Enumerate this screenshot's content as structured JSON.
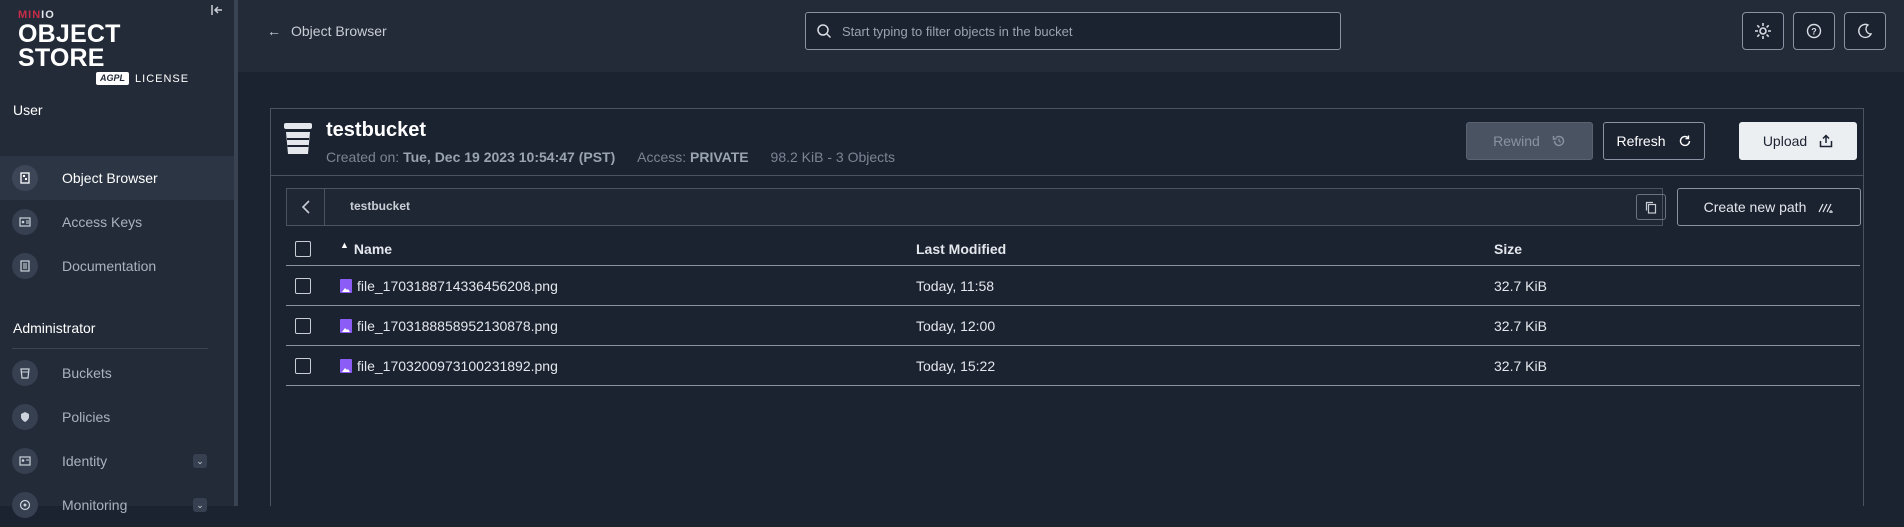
{
  "sidebar": {
    "logo": {
      "brand_minio": "MIN",
      "brand_io": "IO",
      "product": "OBJECT STORE",
      "badge": "AGPL",
      "license": "LICENSE"
    },
    "sections": {
      "user": "User",
      "administrator": "Administrator"
    },
    "user_items": [
      {
        "label": "Object Browser",
        "icon": "object-browser-icon",
        "active": true
      },
      {
        "label": "Access Keys",
        "icon": "access-keys-icon",
        "active": false
      },
      {
        "label": "Documentation",
        "icon": "documentation-icon",
        "active": false
      }
    ],
    "admin_items": [
      {
        "label": "Buckets",
        "icon": "buckets-icon"
      },
      {
        "label": "Policies",
        "icon": "policies-icon"
      },
      {
        "label": "Identity",
        "icon": "identity-icon",
        "expandable": true
      },
      {
        "label": "Monitoring",
        "icon": "monitoring-icon",
        "expandable": true
      }
    ]
  },
  "header": {
    "back_label": "Object Browser",
    "search_placeholder": "Start typing to filter objects in the bucket"
  },
  "bucket": {
    "name": "testbucket",
    "created_label": "Created on:",
    "created_value": "Tue, Dec 19 2023 10:54:47 (PST)",
    "access_label": "Access:",
    "access_value": "PRIVATE",
    "summary": "98.2 KiB - 3 Objects"
  },
  "actions": {
    "rewind": "Rewind",
    "refresh": "Refresh",
    "upload": "Upload",
    "create_path": "Create new path"
  },
  "breadcrumb": {
    "path": "testbucket"
  },
  "table": {
    "columns": {
      "name": "Name",
      "modified": "Last Modified",
      "size": "Size"
    },
    "rows": [
      {
        "name": "file_1703188714336456208.png",
        "modified": "Today, 11:58",
        "size": "32.7 KiB"
      },
      {
        "name": "file_1703188858952130878.png",
        "modified": "Today, 12:00",
        "size": "32.7 KiB"
      },
      {
        "name": "file_1703200973100231892.png",
        "modified": "Today, 15:22",
        "size": "32.7 KiB"
      }
    ]
  },
  "colors": {
    "background": "#1b2230",
    "sidebar": "#232b38",
    "brand_red": "#c72c48",
    "file_icon": "#8b5cf6"
  }
}
